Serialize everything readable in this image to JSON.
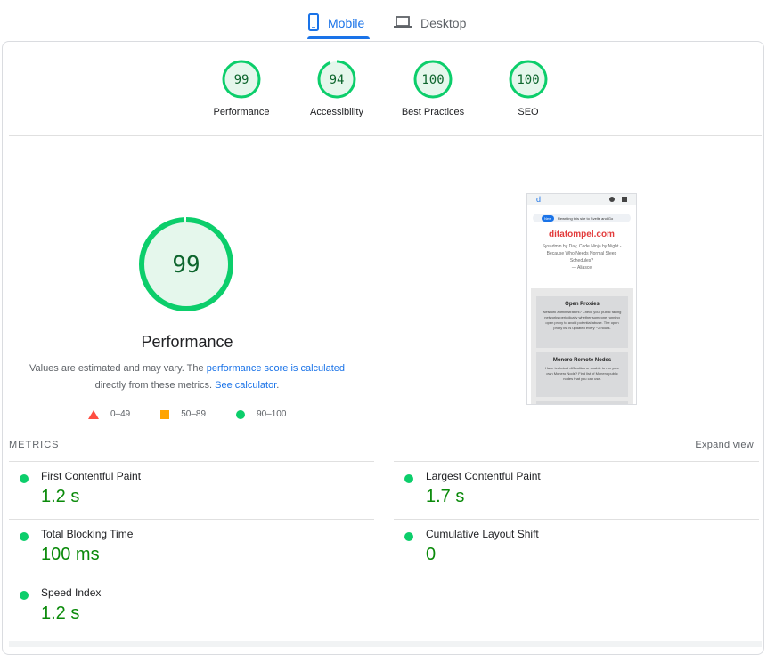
{
  "tabs": [
    {
      "label": "Mobile",
      "icon": "smartphone-icon",
      "active": true
    },
    {
      "label": "Desktop",
      "icon": "laptop-icon",
      "active": false
    }
  ],
  "categories": [
    {
      "label": "Performance",
      "score": 99
    },
    {
      "label": "Accessibility",
      "score": 94
    },
    {
      "label": "Best Practices",
      "score": 100
    },
    {
      "label": "SEO",
      "score": 100
    }
  ],
  "performance": {
    "score": 99,
    "title": "Performance",
    "desc_prefix": "Values are estimated and may vary. The ",
    "desc_link1": "performance score is calculated",
    "desc_mid": "directly from these metrics. ",
    "desc_link2": "See calculator",
    "desc_end": "."
  },
  "legend": [
    {
      "range": "0–49",
      "shape": "triangle",
      "color": "#ff4e42"
    },
    {
      "range": "50–89",
      "shape": "square",
      "color": "#ffa400"
    },
    {
      "range": "90–100",
      "shape": "circle",
      "color": "#0cce6b"
    }
  ],
  "screenshot": {
    "banner": "Rewriting this site to Svelte and Go",
    "badge": "New",
    "site_name": "ditatompel.com",
    "tagline": "Sysadmin by Day, Code Ninja by Night - Because Who Needs Normal Sleep Schedules?",
    "author": "— Aliasce",
    "card1_title": "Open Proxies",
    "card1_text": "Network administrators? Check your public facing networks periodically whether someone running open proxy to avoid potential abuse. The open proxy list is updated every ~2 hours.",
    "card2_title": "Monero Remote Nodes",
    "card2_text": "Have technical difficulties or unable to run your own Monero Node? Find list of Monero public nodes that you can use."
  },
  "metrics_section": {
    "label": "METRICS",
    "expand": "Expand view"
  },
  "metrics": [
    {
      "name": "First Contentful Paint",
      "value": "1.2 s"
    },
    {
      "name": "Largest Contentful Paint",
      "value": "1.7 s"
    },
    {
      "name": "Total Blocking Time",
      "value": "100 ms"
    },
    {
      "name": "Cumulative Layout Shift",
      "value": "0"
    },
    {
      "name": "Speed Index",
      "value": "1.2 s"
    }
  ],
  "colors": {
    "pass": "#0cce6b",
    "pass_text": "#0a8a0a",
    "accent": "#1a73e8"
  }
}
